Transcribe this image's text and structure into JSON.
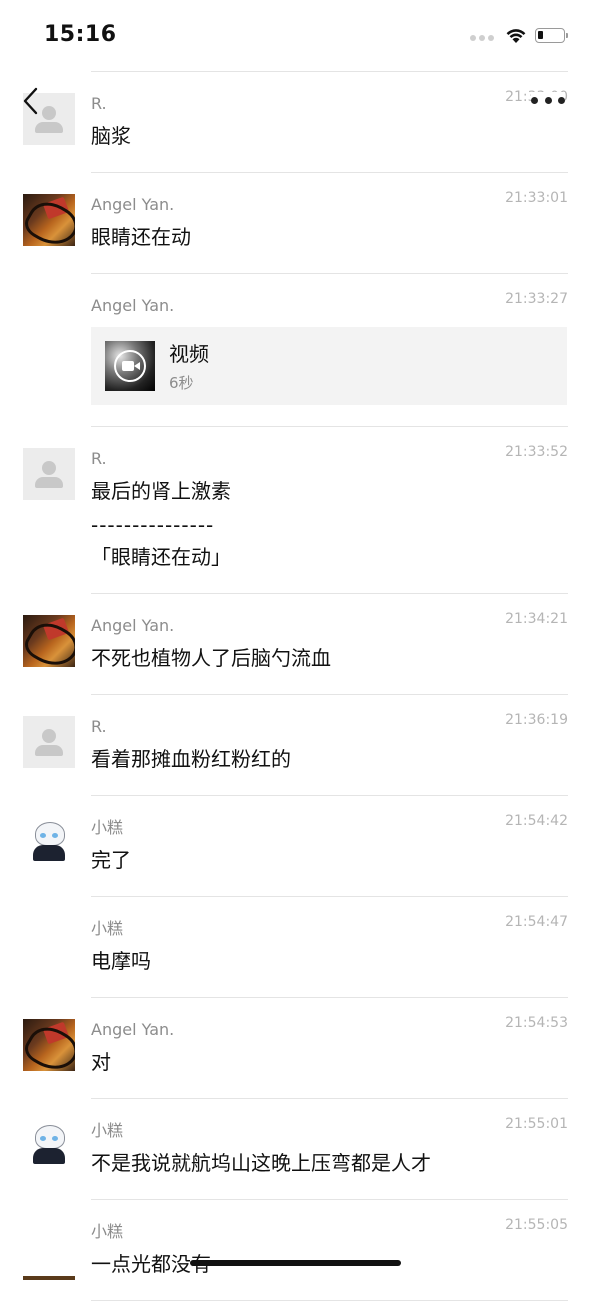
{
  "status_bar": {
    "time": "15:16",
    "battery_level": 0.2
  },
  "nav": {
    "back_icon": "chevron-left-icon",
    "more_icon": "more-dots-icon"
  },
  "messages": [
    {
      "sender": "R.",
      "time": "21:33:00",
      "avatar": "default",
      "type": "text",
      "text": "脑浆"
    },
    {
      "sender": "Angel Yan.",
      "time": "21:33:01",
      "avatar": "angel",
      "type": "text",
      "text": "眼睛还在动"
    },
    {
      "sender": "Angel Yan.",
      "time": "21:33:27",
      "avatar": "none",
      "type": "video",
      "video_title": "视频",
      "video_duration": "6秒"
    },
    {
      "sender": "R.",
      "time": "21:33:52",
      "avatar": "default",
      "type": "quote",
      "text": "最后的肾上激素",
      "separator": "---------------",
      "quote": "「眼睛还在动」"
    },
    {
      "sender": "Angel Yan.",
      "time": "21:34:21",
      "avatar": "angel",
      "type": "text",
      "text": "不死也植物人了后脑勺流血"
    },
    {
      "sender": "R.",
      "time": "21:36:19",
      "avatar": "default",
      "type": "text",
      "text": "看着那摊血粉红粉红的"
    },
    {
      "sender": "小糕",
      "time": "21:54:42",
      "avatar": "xiaogao",
      "type": "text",
      "text": "完了"
    },
    {
      "sender": "小糕",
      "time": "21:54:47",
      "avatar": "none",
      "type": "text",
      "text": "电摩吗"
    },
    {
      "sender": "Angel Yan.",
      "time": "21:54:53",
      "avatar": "angel",
      "type": "text",
      "text": "对"
    },
    {
      "sender": "小糕",
      "time": "21:55:01",
      "avatar": "xiaogao",
      "type": "text",
      "text": "不是我说就航坞山这晚上压弯都是人才"
    },
    {
      "sender": "小糕",
      "time": "21:55:05",
      "avatar": "none",
      "type": "text",
      "text": "一点光都没有"
    }
  ]
}
